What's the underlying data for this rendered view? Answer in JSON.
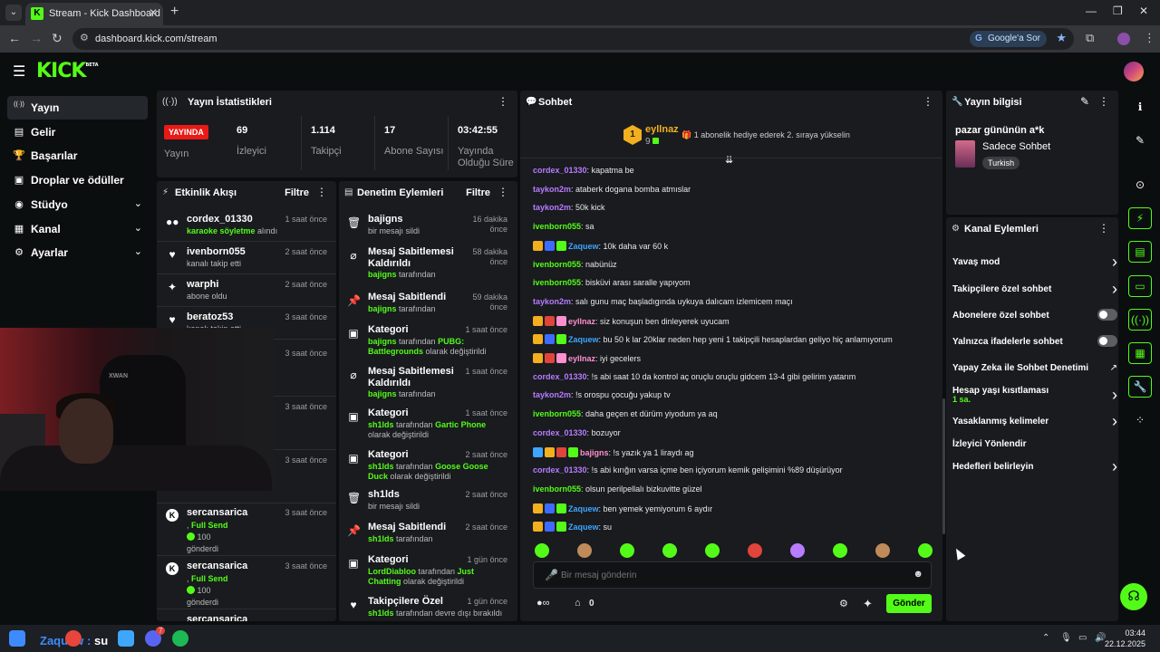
{
  "browser": {
    "tab_title": "Stream - Kick Dashboard",
    "url": "dashboard.kick.com/stream",
    "google_ask": "Google'a Sor"
  },
  "header": {
    "logo": "KICK",
    "logo_badge": "BETA"
  },
  "nav": [
    {
      "label": "Yayın",
      "icon": "broadcast-icon",
      "glyph": "((·))",
      "active": true,
      "expandable": false
    },
    {
      "label": "Gelir",
      "icon": "wallet-icon",
      "glyph": "▤",
      "active": false,
      "expandable": false
    },
    {
      "label": "Başarılar",
      "icon": "trophy-icon",
      "glyph": "🏆",
      "active": false,
      "expandable": false
    },
    {
      "label": "Droplar ve ödüller",
      "icon": "gift-icon",
      "glyph": "▣",
      "active": false,
      "expandable": false
    },
    {
      "label": "Stüdyo",
      "icon": "studio-icon",
      "glyph": "◉",
      "active": false,
      "expandable": true
    },
    {
      "label": "Kanal",
      "icon": "channel-icon",
      "glyph": "▦",
      "active": false,
      "expandable": true
    },
    {
      "label": "Ayarlar",
      "icon": "settings-icon",
      "glyph": "⚙",
      "active": false,
      "expandable": true
    }
  ],
  "stats": {
    "title": "Yayın İstatistikleri",
    "live_label": "YAYINDA",
    "status_label": "Yayın",
    "viewers": {
      "value": "69",
      "label": "İzleyici"
    },
    "followers": {
      "value": "1.114",
      "label": "Takipçi"
    },
    "subs": {
      "value": "17",
      "label": "Abone Sayısı"
    },
    "uptime": {
      "value": "03:42:55",
      "label_1": "Yayında",
      "label_2": "Olduğu Süre"
    }
  },
  "activity": {
    "title": "Etkinlik Akışı",
    "filter": "Filtre",
    "events": [
      {
        "name": "cordex_01330",
        "desc_prefix": "",
        "desc_hl": "karaoke söyletme",
        "desc_suffix": " alındı",
        "time": "1 saat önce",
        "icon": "redeem-icon",
        "glyph": "●●"
      },
      {
        "name": "ivenborn055",
        "desc_prefix": "kanalı takip etti",
        "desc_hl": "",
        "desc_suffix": "",
        "time": "2 saat önce",
        "icon": "heart-icon",
        "glyph": "♥"
      },
      {
        "name": "warphi",
        "desc_prefix": "abone oldu",
        "desc_hl": "",
        "desc_suffix": "",
        "time": "2 saat önce",
        "icon": "star-icon",
        "glyph": "✦"
      },
      {
        "name": "beratoz53",
        "desc_prefix": "kanalı takip etti",
        "desc_hl": "",
        "desc_suffix": "",
        "time": "3 saat önce",
        "icon": "heart-icon",
        "glyph": "♥"
      }
    ],
    "hidden_times": [
      "3 saat önce",
      "3 saat önce",
      "3 saat önce"
    ],
    "gifts": [
      {
        "name": "sercansarica",
        "desc_hl": "Full Send",
        "amount": "100",
        "desc_suffix": "gönderdi",
        "time": "3 saat önce"
      },
      {
        "name": "sercansarica",
        "desc_hl": "Full Send",
        "amount": "100",
        "desc_suffix": "gönderdi",
        "time": "3 saat önce"
      }
    ],
    "partial_name": "sercansarica"
  },
  "moderation": {
    "title": "Denetim Eylemleri",
    "filter": "Filtre",
    "items": [
      {
        "name": "bajigns",
        "desc": "bir mesajı sildi",
        "time": "16 dakika önce",
        "icon": "trash-icon",
        "glyph": "🗑"
      },
      {
        "name": "Mesaj Sabitlemesi Kaldırıldı",
        "desc_hl": "bajigns",
        "desc": " tarafından",
        "time": "58 dakika önce",
        "icon": "unpin-icon",
        "glyph": "⌀"
      },
      {
        "name": "Mesaj Sabitlendi",
        "desc_hl": "bajigns",
        "desc": " tarafından",
        "time": "59 dakika önce",
        "icon": "pin-icon",
        "glyph": "📌"
      },
      {
        "name": "Kategori",
        "desc_hl": "bajigns",
        "desc": " tarafından ",
        "desc_hl2": "PUBG: Battlegrounds",
        "desc_tail": " olarak değiştirildi",
        "time": "1 saat önce",
        "icon": "category-icon",
        "glyph": "▣"
      },
      {
        "name": "Mesaj Sabitlemesi Kaldırıldı",
        "desc_hl": "bajigns",
        "desc": " tarafından",
        "time": "1 saat önce",
        "icon": "unpin-icon",
        "glyph": "⌀"
      },
      {
        "name": "Kategori",
        "desc_hl": "sh1lds",
        "desc": " tarafından ",
        "desc_hl2": "Gartic Phone",
        "desc_tail": " olarak değiştirildi",
        "time": "1 saat önce",
        "icon": "category-icon",
        "glyph": "▣"
      },
      {
        "name": "Kategori",
        "desc_hl": "sh1lds",
        "desc": " tarafından ",
        "desc_hl2": "Goose Goose Duck",
        "desc_tail": " olarak değiştirildi",
        "time": "2 saat önce",
        "icon": "category-icon",
        "glyph": "▣"
      },
      {
        "name": "sh1lds",
        "desc": "bir mesajı sildi",
        "time": "2 saat önce",
        "icon": "trash-icon",
        "glyph": "🗑"
      },
      {
        "name": "Mesaj Sabitlendi",
        "desc_hl": "sh1lds",
        "desc": " tarafından",
        "time": "2 saat önce",
        "icon": "pin-icon",
        "glyph": "📌"
      },
      {
        "name": "Kategori",
        "desc_hl": "LordDiabloo",
        "desc": " tarafından ",
        "desc_hl2": "Just Chatting",
        "desc_tail": " olarak değiştirildi",
        "time": "1 gün önce",
        "icon": "category-icon",
        "glyph": "▣"
      },
      {
        "name": "Takipçilere Özel",
        "desc_hl": "sh1lds",
        "desc": " tarafından devre dışı bırakıldı",
        "time": "1 gün önce",
        "icon": "heart-icon",
        "glyph": "♥"
      }
    ]
  },
  "chat": {
    "title": "Sohbet",
    "pinned": {
      "rank": "1",
      "name": "eyllnaz",
      "count": "9",
      "message": "1 abonelik hediye ederek 2. sıraya yükselin"
    },
    "messages": [
      {
        "user": "cordex_01330",
        "color": "#b77cff",
        "text": "kapatma be",
        "badges": []
      },
      {
        "user": "taykon2m",
        "color": "#b77cff",
        "text": "ataberk dogana bomba atmıslar",
        "badges": []
      },
      {
        "user": "taykon2m",
        "color": "#b77cff",
        "text": "50k kick",
        "badges": []
      },
      {
        "user": "ivenborn055",
        "color": "#53fc18",
        "text": "sa",
        "badges": []
      },
      {
        "user": "Zaquew",
        "color": "#3ea6ff",
        "text": "10k daha var 60 k",
        "badges": [
          "#f2b01e",
          "#3e6bff",
          "#53fc18"
        ]
      },
      {
        "user": "ivenborn055",
        "color": "#53fc18",
        "text": "nabünüz",
        "badges": []
      },
      {
        "user": "ivenborn055",
        "color": "#53fc18",
        "text": "bisküvi arası saralle yapıyom",
        "badges": []
      },
      {
        "user": "taykon2m",
        "color": "#b77cff",
        "text": "salı gunu maç başladıgında uykuya dalıcam izlemicem maçı",
        "badges": []
      },
      {
        "user": "eyllnaz",
        "color": "#ff8fcf",
        "text": "siz konuşun ben dinleyerek uyucam",
        "badges": [
          "#f2b01e",
          "#e0443a",
          "#ff8fcf"
        ]
      },
      {
        "user": "Zaquew",
        "color": "#3ea6ff",
        "text": "bu 50 k lar 20klar neden hep yeni 1 takipçili hesaplardan geliyo hiç anlamıyorum",
        "badges": [
          "#f2b01e",
          "#3e6bff",
          "#53fc18"
        ]
      },
      {
        "user": "eyllnaz",
        "color": "#ff8fcf",
        "text": "iyi gecelers",
        "badges": [
          "#f2b01e",
          "#e0443a",
          "#ff8fcf"
        ]
      },
      {
        "user": "cordex_01330",
        "color": "#b77cff",
        "text": "!s abi saat 10 da kontrol aç oruçlu oruçlu gidcem 13-4 gibi gelirim yatarım",
        "badges": []
      },
      {
        "user": "taykon2m",
        "color": "#b77cff",
        "text": "!s orospu çocuğu yakup tv",
        "badges": []
      },
      {
        "user": "ivenborn055",
        "color": "#53fc18",
        "text": "daha geçen et dürüm yiyodum ya aq",
        "badges": []
      },
      {
        "user": "cordex_01330",
        "color": "#b77cff",
        "text": "bozuyor",
        "badges": []
      },
      {
        "user": "bajigns",
        "color": "#ff8fcf",
        "text": "!s yazık ya 1 liraydı ag",
        "badges": [
          "#3ea6ff",
          "#f2b01e",
          "#e0443a",
          "#53fc18"
        ]
      },
      {
        "user": "cordex_01330",
        "color": "#b77cff",
        "text": "!s abi kırığın varsa içme ben içiyorum kemik gelişimini %89 düşürüyor",
        "badges": []
      },
      {
        "user": "ivenborn055",
        "color": "#53fc18",
        "text": "olsun perilpellalı bizkuvitte güzel",
        "badges": []
      },
      {
        "user": "Zaquew",
        "color": "#3ea6ff",
        "text": "ben yemek yemiyorum 6 aydır",
        "badges": [
          "#f2b01e",
          "#3e6bff",
          "#53fc18"
        ]
      },
      {
        "user": "Zaquew",
        "color": "#3ea6ff",
        "text": "su",
        "badges": [
          "#f2b01e",
          "#3e6bff",
          "#53fc18"
        ]
      }
    ],
    "emotes": [
      "#53fc18",
      "#c08a5a",
      "#53fc18",
      "#53fc18",
      "#53fc18",
      "#e0443a",
      "#b77cff",
      "#53fc18",
      "#c08a5a",
      "#53fc18"
    ],
    "input_placeholder": "Bir mesaj gönderin",
    "points": "0",
    "send": "Gönder"
  },
  "stream_info": {
    "title": "Yayın bilgisi",
    "stream_title": "pazar gününün a*k",
    "category": "Sadece Sohbet",
    "tag": "Turkish"
  },
  "channel_actions": {
    "title": "Kanal Eylemleri",
    "items": [
      {
        "label": "Yavaş mod",
        "control": "chevron"
      },
      {
        "label": "Takipçilere özel sohbet",
        "control": "chevron"
      },
      {
        "label": "Abonelere özel sohbet",
        "control": "toggle"
      },
      {
        "label": "Yalnızca ifadelerle sohbet",
        "control": "toggle"
      },
      {
        "label": "Yapay Zeka ile Sohbet Denetimi",
        "control": "external"
      },
      {
        "label": "Hesap yaşı kısıtlaması",
        "sub": "1 sa.",
        "control": "chevron"
      },
      {
        "label": "Yasaklanmış kelimeler",
        "control": "chevron"
      },
      {
        "label": "İzleyici Yönlendir",
        "control": "none"
      },
      {
        "label": "Hedefleri belirleyin",
        "control": "chevron"
      }
    ]
  },
  "webcam": {
    "chair_text": "XWAN"
  },
  "taskbar": {
    "overlay_user": "Zaquew",
    "overlay_text": "su",
    "time": "03:44",
    "date": "22.12.2025",
    "badge": "7"
  }
}
